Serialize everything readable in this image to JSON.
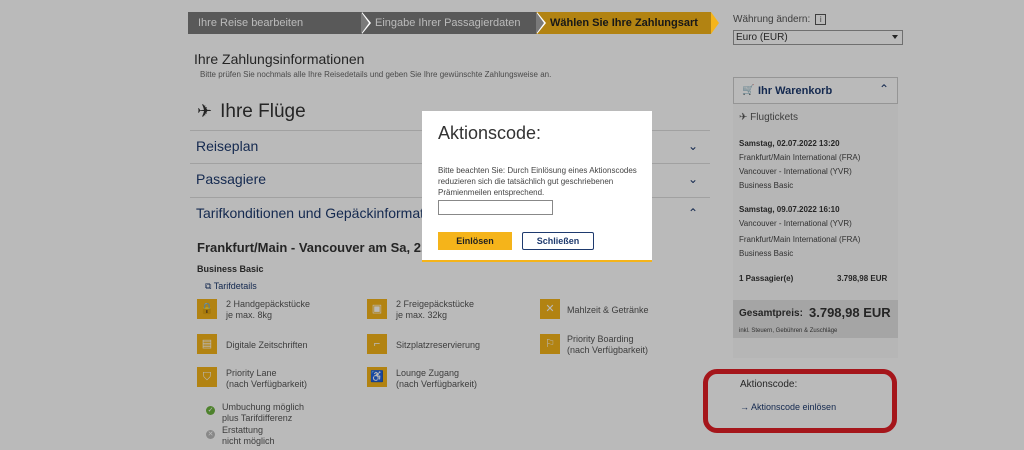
{
  "steps": [
    "Ihre Reise bearbeiten",
    "Eingabe Ihrer Passagierdaten",
    "Wählen Sie Ihre Zahlungsart"
  ],
  "currency": {
    "label": "Währung ändern:",
    "info_icon": "i",
    "selected": "Euro (EUR)"
  },
  "payment": {
    "title": "Ihre Zahlungsinformationen",
    "subtitle": "Bitte prüfen Sie nochmals alle Ihre Reisedetails und geben Sie Ihre gewünschte Zahlungsweise an."
  },
  "flights": {
    "title": "Ihre Flüge",
    "sections": [
      "Reiseplan",
      "Passagiere",
      "Tarifkonditionen und Gepäckinformationen"
    ],
    "route": "Frankfurt/Main - Vancouver am Sa, 2.7.2",
    "fare_class": "Business Basic",
    "tarif_link": "Tarifdetails"
  },
  "features": [
    {
      "icon": "bag-icon",
      "text1": "2 Handgepäckstücke",
      "text2": "je max. 8kg"
    },
    {
      "icon": "suitcase-icon",
      "text1": "2 Freigepäckstücke",
      "text2": "je max. 32kg"
    },
    {
      "icon": "meal-icon",
      "text1": "Mahlzeit & Getränke",
      "text2": ""
    },
    {
      "icon": "newspaper-icon",
      "text1": "Digitale Zeitschriften",
      "text2": ""
    },
    {
      "icon": "seat-icon",
      "text1": "Sitzplatzreservierung",
      "text2": ""
    },
    {
      "icon": "boarding-icon",
      "text1": "Priority Boarding",
      "text2": "(nach Verfügbarkeit)"
    },
    {
      "icon": "priority-lane-icon",
      "text1": "Priority Lane",
      "text2": "(nach Verfügbarkeit)"
    },
    {
      "icon": "lounge-icon",
      "text1": "Lounge Zugang",
      "text2": "(nach Verfügbarkeit)"
    }
  ],
  "conditions": [
    {
      "status": "yes",
      "text1": "Umbuchung möglich",
      "text2": "plus Tarifdifferenz"
    },
    {
      "status": "no",
      "text1": "Erstattung",
      "text2": "nicht möglich"
    }
  ],
  "cart": {
    "title": "Ihr Warenkorb",
    "section": "Flugtickets",
    "flight1": {
      "date": "Samstag, 02.07.2022 13:20",
      "from": "Frankfurt/Main International (FRA)",
      "to": "Vancouver - International (YVR)",
      "fare": "Business Basic"
    },
    "flight2": {
      "date": "Samstag, 09.07.2022 16:10",
      "from": "Vancouver - International (YVR)",
      "to": "Frankfurt/Main International (FRA)",
      "fare": "Business Basic"
    },
    "passengers": "1 Passagier(e)",
    "passenger_price": "3.798,98 EUR",
    "total_label": "Gesamtpreis:",
    "total_value": "3.798,98 EUR",
    "tax_note": "inkl. Steuern, Gebühren & Zuschläge"
  },
  "promo": {
    "label": "Aktionscode:",
    "link": "Aktionscode einlösen"
  },
  "modal": {
    "title": "Aktionscode:",
    "text": "Bitte beachten Sie: Durch Einlösung eines Aktionscodes reduzieren sich die tatsächlich gut geschriebenen Prämienmeilen entsprechend.",
    "input_value": "",
    "redeem_label": "Einlösen",
    "close_label": "Schließen"
  },
  "colors": {
    "accent": "#f5b41a",
    "navy": "#1e3a6e",
    "highlight": "#e21f26"
  }
}
